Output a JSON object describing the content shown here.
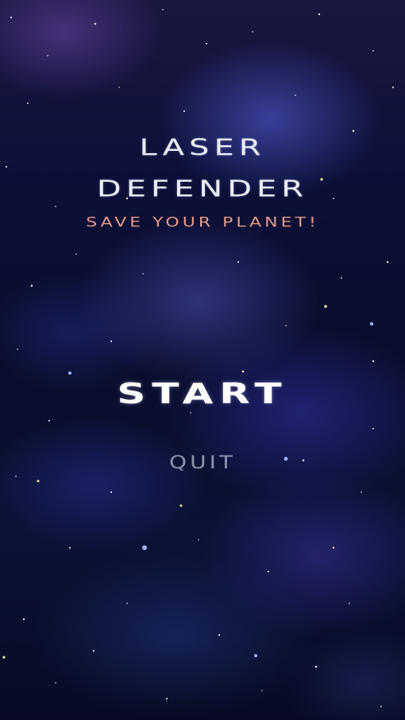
{
  "game": {
    "title_line_1": "LASER",
    "title_line_2": "DEFENDER",
    "subtitle": "SAVE YOUR PLANET!"
  },
  "menu": {
    "start_label": "START",
    "quit_label": "QUIT"
  },
  "colors": {
    "title": "#eceff7",
    "subtitle": "#e89a8a",
    "start": "#ffffff",
    "quit": "#8e93ad",
    "background": "#0a0d2c"
  }
}
